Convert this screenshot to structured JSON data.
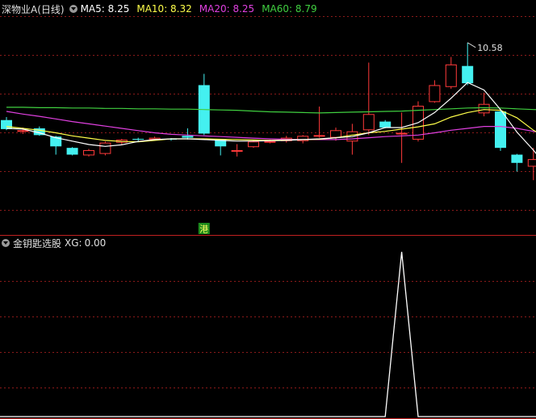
{
  "colors": {
    "background": "#000000",
    "up": "#ff3a3a",
    "down": "#44f0f0",
    "grid": "#8b1a1a",
    "ma5": "#ffffff",
    "ma10": "#ffff4a",
    "ma20": "#e040e0",
    "ma60": "#40d040",
    "xg_line": "#ffffff",
    "tag_bg": "#1c8a1c",
    "tag_fg": "#ffff60"
  },
  "header": {
    "title": "深物业A(日线)",
    "indicators": [
      {
        "label": "MA5:",
        "value": "8.25",
        "color": "#ffffff"
      },
      {
        "label": "MA10:",
        "value": "8.32",
        "color": "#ffff4a"
      },
      {
        "label": "MA20:",
        "value": "8.25",
        "color": "#e040e0"
      },
      {
        "label": "MA60:",
        "value": "8.79",
        "color": "#40d040"
      }
    ]
  },
  "price_annotation": {
    "label": "10.58"
  },
  "event_tag": {
    "label": "港"
  },
  "indicator_header": {
    "title": "金钥匙选股",
    "label": "XG:",
    "value": "0.00"
  },
  "chart_data": {
    "type": "candlestick",
    "y_range": [
      6.0,
      11.2
    ],
    "candles": [
      {
        "o": 8.52,
        "c": 8.28,
        "h": 8.6,
        "l": 8.25
      },
      {
        "o": 8.25,
        "c": 8.25,
        "h": 8.32,
        "l": 8.15
      },
      {
        "o": 8.3,
        "c": 8.12,
        "h": 8.35,
        "l": 8.1
      },
      {
        "o": 8.08,
        "c": 7.82,
        "h": 8.1,
        "l": 7.6
      },
      {
        "o": 7.78,
        "c": 7.6,
        "h": 7.8,
        "l": 7.58
      },
      {
        "o": 7.58,
        "c": 7.72,
        "h": 7.75,
        "l": 7.55
      },
      {
        "o": 7.62,
        "c": 7.92,
        "h": 7.95,
        "l": 7.58
      },
      {
        "o": 7.92,
        "c": 8.0,
        "h": 8.02,
        "l": 7.86
      },
      {
        "o": 8.02,
        "c": 8.0,
        "h": 8.05,
        "l": 7.95
      },
      {
        "o": 8.0,
        "c": 8.05,
        "h": 8.08,
        "l": 7.98
      },
      {
        "o": 8.02,
        "c": 8.0,
        "h": 8.04,
        "l": 7.97
      },
      {
        "o": 8.1,
        "c": 8.05,
        "h": 8.3,
        "l": 8.0
      },
      {
        "o": 9.45,
        "c": 8.16,
        "h": 9.75,
        "l": 8.12
      },
      {
        "o": 8.0,
        "c": 7.82,
        "h": 8.02,
        "l": 7.58
      },
      {
        "o": 7.72,
        "c": 7.72,
        "h": 7.88,
        "l": 7.55
      },
      {
        "o": 7.8,
        "c": 7.95,
        "h": 7.98,
        "l": 7.78
      },
      {
        "o": 7.92,
        "c": 7.96,
        "h": 8.0,
        "l": 7.9
      },
      {
        "o": 7.96,
        "c": 8.05,
        "h": 8.1,
        "l": 7.92
      },
      {
        "o": 7.96,
        "c": 8.1,
        "h": 8.12,
        "l": 7.9
      },
      {
        "o": 8.12,
        "c": 8.12,
        "h": 8.88,
        "l": 8.05
      },
      {
        "o": 8.05,
        "c": 8.25,
        "h": 8.32,
        "l": 7.97
      },
      {
        "o": 7.95,
        "c": 8.22,
        "h": 8.42,
        "l": 7.6
      },
      {
        "o": 8.25,
        "c": 8.68,
        "h": 10.05,
        "l": 8.12
      },
      {
        "o": 8.48,
        "c": 8.32,
        "h": 8.52,
        "l": 8.3
      },
      {
        "o": 8.18,
        "c": 8.18,
        "h": 8.72,
        "l": 7.38
      },
      {
        "o": 8.0,
        "c": 8.9,
        "h": 9.02,
        "l": 7.95
      },
      {
        "o": 9.0,
        "c": 9.45,
        "h": 9.58,
        "l": 8.98
      },
      {
        "o": 9.4,
        "c": 10.0,
        "h": 10.2,
        "l": 9.35
      },
      {
        "o": 9.96,
        "c": 9.5,
        "h": 10.58,
        "l": 9.45
      },
      {
        "o": 8.7,
        "c": 8.95,
        "h": 9.25,
        "l": 8.62
      },
      {
        "o": 8.75,
        "c": 7.78,
        "h": 8.78,
        "l": 7.7
      },
      {
        "o": 7.6,
        "c": 7.38,
        "h": 7.62,
        "l": 7.15
      },
      {
        "o": 7.28,
        "c": 7.48,
        "h": 7.78,
        "l": 6.92
      },
      {
        "o": 6.92,
        "c": 6.32,
        "h": 6.98,
        "l": 6.08
      }
    ],
    "ma5": [
      8.3,
      8.28,
      8.18,
      8.05,
      7.96,
      7.87,
      7.82,
      7.86,
      7.95,
      8.0,
      8.02,
      8.02,
      8.0,
      7.98,
      7.96,
      7.96,
      7.97,
      7.98,
      8.0,
      8.02,
      8.05,
      8.08,
      8.18,
      8.32,
      8.32,
      8.45,
      8.72,
      9.1,
      9.52,
      9.32,
      8.8,
      8.2,
      7.72,
      7.18
    ],
    "ma10": [
      8.35,
      8.3,
      8.25,
      8.18,
      8.1,
      8.04,
      7.98,
      7.95,
      7.94,
      7.98,
      8.02,
      8.02,
      8.02,
      8.01,
      8.0,
      7.99,
      7.98,
      7.99,
      8.0,
      8.01,
      8.05,
      8.12,
      8.18,
      8.22,
      8.28,
      8.34,
      8.42,
      8.6,
      8.72,
      8.8,
      8.78,
      8.58,
      8.25,
      8.0
    ],
    "ma20": [
      8.75,
      8.68,
      8.62,
      8.55,
      8.48,
      8.42,
      8.36,
      8.3,
      8.24,
      8.18,
      8.14,
      8.12,
      8.1,
      8.08,
      8.06,
      8.04,
      8.02,
      8.01,
      8.0,
      8.0,
      8.0,
      8.02,
      8.05,
      8.08,
      8.1,
      8.12,
      8.18,
      8.25,
      8.3,
      8.35,
      8.35,
      8.3,
      8.22,
      8.14
    ],
    "ma60": [
      8.86,
      8.86,
      8.85,
      8.85,
      8.84,
      8.84,
      8.83,
      8.83,
      8.82,
      8.82,
      8.81,
      8.81,
      8.8,
      8.79,
      8.78,
      8.76,
      8.74,
      8.73,
      8.72,
      8.71,
      8.72,
      8.73,
      8.74,
      8.75,
      8.76,
      8.78,
      8.8,
      8.82,
      8.84,
      8.85,
      8.84,
      8.82,
      8.8,
      8.79
    ],
    "xg": {
      "y_range": [
        0,
        1
      ],
      "values": [
        0,
        0,
        0,
        0,
        0,
        0,
        0,
        0,
        0,
        0,
        0,
        0,
        0,
        0,
        0,
        0,
        0,
        0,
        0,
        0,
        0,
        0,
        0,
        0,
        1,
        0,
        0,
        0,
        0,
        0,
        0,
        0,
        0,
        0
      ]
    }
  }
}
